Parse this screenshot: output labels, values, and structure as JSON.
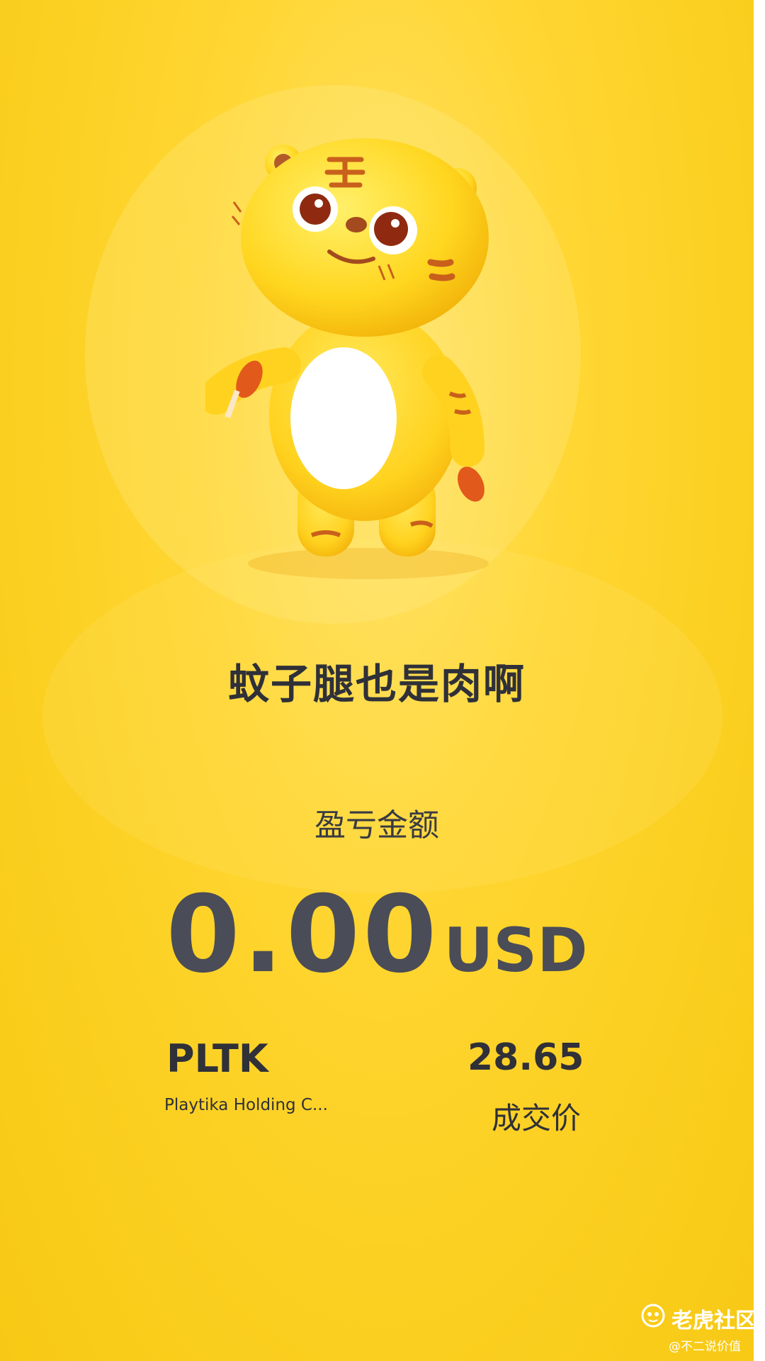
{
  "card": {
    "headline": "蚊子腿也是肉啊",
    "pnl_label": "盈亏金额",
    "pnl_amount": "0.00",
    "pnl_currency": "USD",
    "ticker": "PLTK",
    "company": "Playtika Holding C...",
    "price": "28.65",
    "price_label": "成交价"
  },
  "watermark": {
    "brand": "老虎社区",
    "user": "@不二说价值"
  },
  "colors": {
    "background": "#fbcf1f",
    "text_dark": "#2f3038",
    "amount": "#4a4c57",
    "mascot_body": "#ffd21f",
    "mascot_accent": "#b5561e"
  },
  "icons": {
    "mascot": "tiger-mascot-icon",
    "watermark_logo": "tiger-logo-icon"
  }
}
